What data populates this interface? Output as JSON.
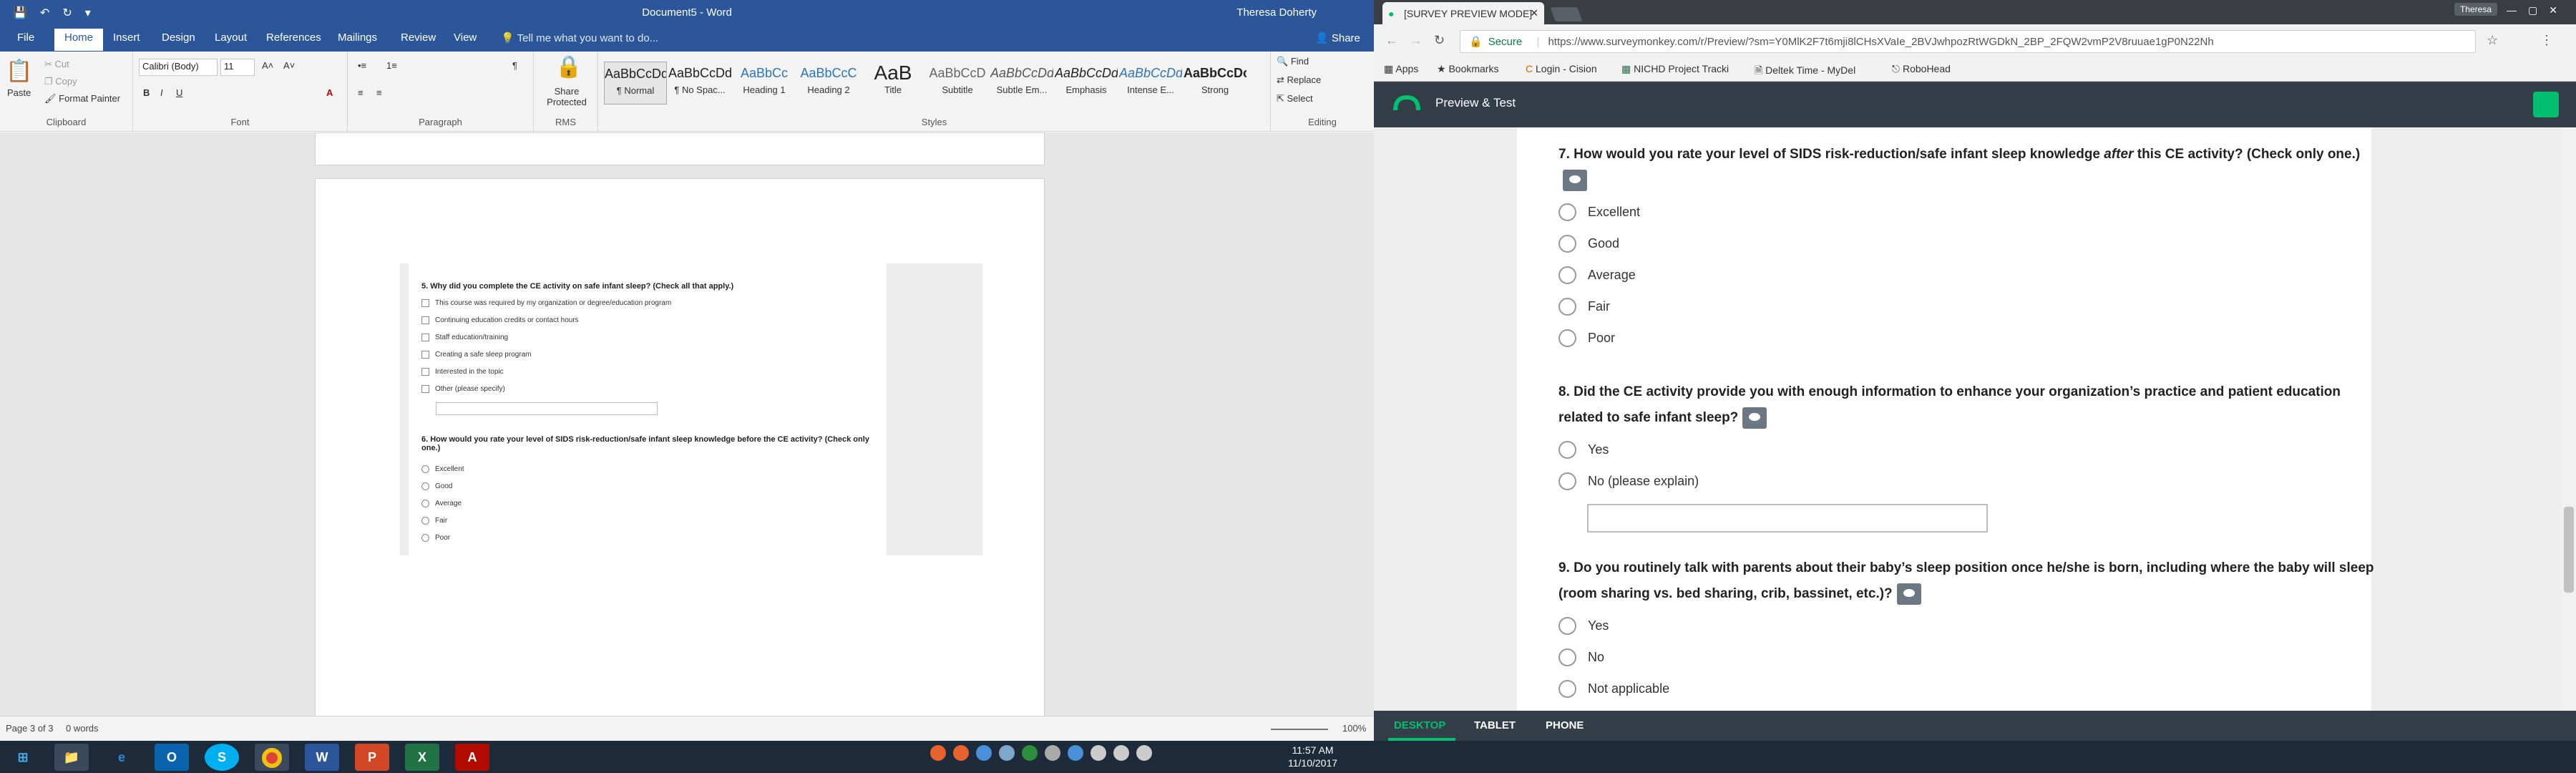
{
  "word": {
    "title": "Document5 - Word",
    "user": "Theresa Doherty",
    "tabs": [
      "File",
      "Home",
      "Insert",
      "Design",
      "Layout",
      "References",
      "Mailings",
      "Review",
      "View"
    ],
    "tell_me": "Tell me what you want to do...",
    "share": "Share",
    "clipboard": {
      "paste": "Paste",
      "cut": "Cut",
      "copy": "Copy",
      "format_painter": "Format Painter",
      "label": "Clipboard"
    },
    "font": {
      "name": "Calibri (Body)",
      "size": "11",
      "label": "Font"
    },
    "paragraph_label": "Paragraph",
    "rms": {
      "share_protected": "Share Protected",
      "label": "RMS"
    },
    "styles": [
      {
        "sample": "AaBbCcDd",
        "name": "¶ Normal"
      },
      {
        "sample": "AaBbCcDd",
        "name": "¶ No Spac..."
      },
      {
        "sample": "AaBbCc",
        "name": "Heading 1"
      },
      {
        "sample": "AaBbCcC",
        "name": "Heading 2"
      },
      {
        "sample": "AaB",
        "name": "Title"
      },
      {
        "sample": "AaBbCcD",
        "name": "Subtitle"
      },
      {
        "sample": "AaBbCcDd",
        "name": "Subtle Em..."
      },
      {
        "sample": "AaBbCcDd",
        "name": "Emphasis"
      },
      {
        "sample": "AaBbCcDd",
        "name": "Intense E..."
      },
      {
        "sample": "AaBbCcDc",
        "name": "Strong"
      }
    ],
    "styles_label": "Styles",
    "editing": {
      "find": "Find",
      "replace": "Replace",
      "select": "Select",
      "label": "Editing"
    },
    "status": {
      "page": "Page 3 of 3",
      "words": "0 words",
      "zoom": "100%"
    },
    "embedded": {
      "q5": "5. Why did you complete the CE activity on safe infant sleep? (Check all that apply.)",
      "q5_options": [
        "This course was required by my organization or degree/education program",
        "Continuing education credits or contact hours",
        "Staff education/training",
        "Creating a safe sleep program",
        "Interested in the topic",
        "Other (please specify)"
      ],
      "q6": "6. How would you rate your level of SIDS risk-reduction/safe infant sleep knowledge before the CE activity? (Check only one.)",
      "q6_options": [
        "Excellent",
        "Good",
        "Average",
        "Fair",
        "Poor"
      ]
    }
  },
  "chrome": {
    "tab_title": "[SURVEY PREVIEW MODE]",
    "user": "Theresa",
    "secure": "Secure",
    "url": "https://www.surveymonkey.com/r/Preview/?sm=Y0MlK2F7t6mji8lCHsXVaIe_2BVJwhpozRtWGDkN_2BP_2FQW2vmP2V8ruuae1gP0N22Nh",
    "bookmarks": [
      "Apps",
      "Bookmarks",
      "Login - Cision",
      "NICHD Project Tracki",
      "Deltek Time - MyDel",
      "RoboHead"
    ],
    "header_title": "Preview & Test",
    "q7": {
      "title_pre": "7. How would you rate your level of SIDS risk-reduction/safe infant sleep knowledge ",
      "title_em": "after",
      "title_post": " this CE activity? (Check only one.)",
      "options": [
        "Excellent",
        "Good",
        "Average",
        "Fair",
        "Poor"
      ]
    },
    "q8": {
      "title": "8. Did the CE activity provide you with enough information to enhance your organization’s practice and patient education related to safe infant sleep?",
      "options": [
        "Yes",
        "No (please explain)"
      ]
    },
    "q9": {
      "title": "9. Do you routinely talk with parents about their baby’s sleep position once he/she is born, including where the baby will sleep (room sharing vs. bed sharing, crib, bassinet, etc.)?",
      "options": [
        "Yes",
        "No",
        "Not applicable"
      ]
    },
    "devices": [
      "DESKTOP",
      "TABLET",
      "PHONE"
    ]
  },
  "taskbar": {
    "time": "11:57 AM",
    "date": "11/10/2017",
    "apps": [
      "start-icon",
      "file-explorer-icon",
      "internet-explorer-icon",
      "outlook-icon",
      "skype-icon",
      "chrome-icon",
      "word-icon",
      "powerpoint-icon",
      "excel-icon",
      "acrobat-icon"
    ]
  },
  "colors": {
    "word_blue": "#2b579a",
    "sm_dark": "#333e48",
    "sm_green": "#00bf6f"
  }
}
